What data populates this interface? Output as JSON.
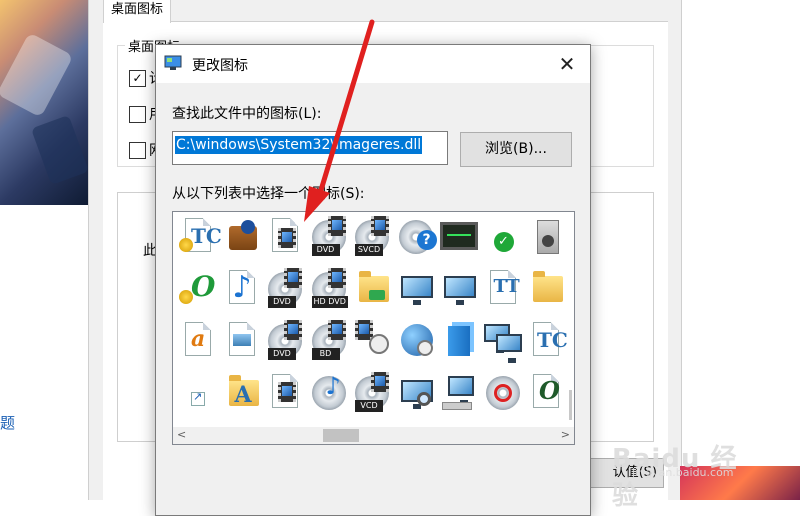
{
  "background": {
    "link_text": "题",
    "tab_label": "桌面图标",
    "group_title": "桌面图标",
    "checkbox_chars": [
      "计",
      "用",
      "网"
    ],
    "checkbox_states": [
      true,
      false,
      false
    ],
    "snippet_text": "此",
    "restore_button": "认值(S)"
  },
  "dialog": {
    "title": "更改图标",
    "close_glyph": "✕",
    "lookup_label": "查找此文件中的图标(L):",
    "path_value": "C:\\windows\\System32\\imageres.dll",
    "browse_label": "浏览(B)...",
    "select_label": "从以下列表中选择一个图标(S):",
    "icons": [
      {
        "kind": "tc-cert",
        "name": "certificate-tc-icon"
      },
      {
        "kind": "briefcase",
        "name": "briefcase-user-icon"
      },
      {
        "kind": "music-film",
        "name": "media-file-icon"
      },
      {
        "kind": "disc",
        "badge": "DVD",
        "name": "dvd-disc-icon"
      },
      {
        "kind": "disc",
        "badge": "SVCD",
        "name": "svcd-disc-icon"
      },
      {
        "kind": "disc-help",
        "name": "disc-help-icon"
      },
      {
        "kind": "screen",
        "name": "performance-monitor-icon"
      },
      {
        "kind": "check",
        "name": "green-check-icon"
      },
      {
        "kind": "speaker",
        "name": "speaker-icon"
      },
      {
        "kind": "o-cert",
        "name": "certificate-font-o-icon"
      },
      {
        "kind": "music",
        "name": "music-file-icon"
      },
      {
        "kind": "disc",
        "badge": "DVD",
        "name": "dvd-disc-icon"
      },
      {
        "kind": "disc",
        "badge": "HD DVD",
        "name": "hd-dvd-disc-icon"
      },
      {
        "kind": "folder-net",
        "name": "network-folder-icon"
      },
      {
        "kind": "monitor",
        "name": "monitor-sync-icon"
      },
      {
        "kind": "monitor",
        "name": "monitor-blue-icon"
      },
      {
        "kind": "tt",
        "name": "truetype-font-icon"
      },
      {
        "kind": "folder",
        "name": "folder-icon"
      },
      {
        "kind": "a-doc",
        "name": "font-a-file-icon"
      },
      {
        "kind": "image-doc",
        "name": "image-file-icon"
      },
      {
        "kind": "disc",
        "badge": "DVD",
        "name": "dvd-disc-icon"
      },
      {
        "kind": "disc",
        "badge": "BD",
        "name": "bluray-disc-icon"
      },
      {
        "kind": "clock-film",
        "name": "video-clock-icon"
      },
      {
        "kind": "globe",
        "name": "globe-clock-icon"
      },
      {
        "kind": "cube",
        "name": "blue-cube-icon"
      },
      {
        "kind": "monitors",
        "name": "network-monitors-icon"
      },
      {
        "kind": "tc",
        "name": "font-tc-icon"
      },
      {
        "kind": "shortcut",
        "name": "shortcut-arrow-icon"
      },
      {
        "kind": "folder-a",
        "name": "font-folder-icon"
      },
      {
        "kind": "film-doc",
        "name": "video-file-icon"
      },
      {
        "kind": "disc-music",
        "name": "music-disc-icon"
      },
      {
        "kind": "disc",
        "badge": "VCD",
        "name": "vcd-disc-icon"
      },
      {
        "kind": "monitor-search",
        "name": "search-monitor-icon"
      },
      {
        "kind": "keyboard-pc",
        "name": "computer-keyboard-icon"
      },
      {
        "kind": "disc-red",
        "name": "disc-burn-icon"
      },
      {
        "kind": "o-doc",
        "name": "font-o-file-icon"
      },
      {
        "kind": "shortcut-user",
        "name": "user-shortcut-icon"
      }
    ],
    "scroll_left": "<",
    "scroll_right": ">"
  },
  "watermark": {
    "brand": "Baidu 经验",
    "url": "jingyan.baidu.com"
  },
  "colors": {
    "selection": "#0078d7",
    "annotation_arrow": "#e0201f"
  }
}
